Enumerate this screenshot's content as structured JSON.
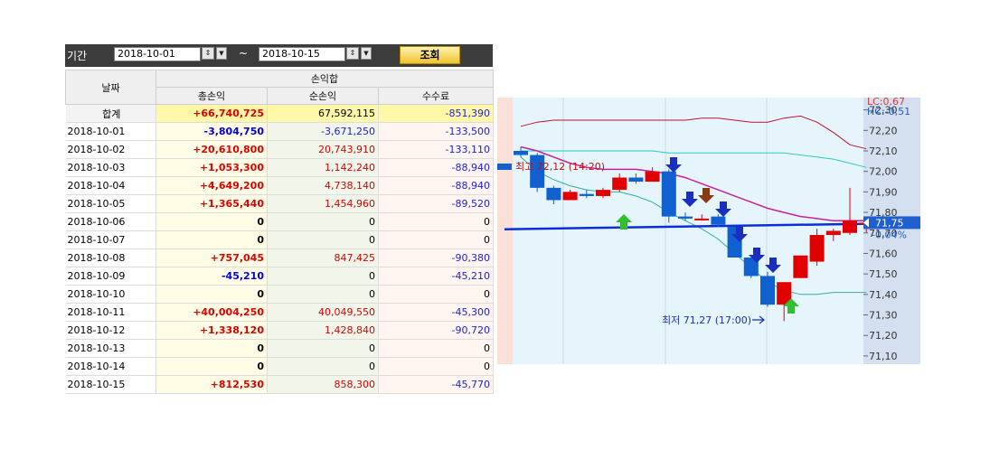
{
  "toolbar": {
    "period_label": "기간",
    "start_date": "2018-10-01",
    "separator": "~",
    "end_date": "2018-10-15",
    "query_label": "조회"
  },
  "table": {
    "header_date": "날짜",
    "header_group": "손익합",
    "col_total": "총손익",
    "col_net": "순손익",
    "col_fee": "수수료",
    "summary": {
      "label": "합계",
      "total": "+66,740,725",
      "net": "67,592,115",
      "fee": "-851,390"
    },
    "rows": [
      {
        "date": "2018-10-01",
        "total": "-3,804,750",
        "net": "-3,671,250",
        "fee": "-133,500"
      },
      {
        "date": "2018-10-02",
        "total": "+20,610,800",
        "net": "20,743,910",
        "fee": "-133,110"
      },
      {
        "date": "2018-10-03",
        "total": "+1,053,300",
        "net": "1,142,240",
        "fee": "-88,940"
      },
      {
        "date": "2018-10-04",
        "total": "+4,649,200",
        "net": "4,738,140",
        "fee": "-88,940"
      },
      {
        "date": "2018-10-05",
        "total": "+1,365,440",
        "net": "1,454,960",
        "fee": "-89,520"
      },
      {
        "date": "2018-10-06",
        "total": "0",
        "net": "0",
        "fee": "0"
      },
      {
        "date": "2018-10-07",
        "total": "0",
        "net": "0",
        "fee": "0"
      },
      {
        "date": "2018-10-08",
        "total": "+757,045",
        "net": "847,425",
        "fee": "-90,380"
      },
      {
        "date": "2018-10-09",
        "total": "-45,210",
        "net": "0",
        "fee": "-45,210"
      },
      {
        "date": "2018-10-10",
        "total": "0",
        "net": "0",
        "fee": "0"
      },
      {
        "date": "2018-10-11",
        "total": "+40,004,250",
        "net": "40,049,550",
        "fee": "-45,300"
      },
      {
        "date": "2018-10-12",
        "total": "+1,338,120",
        "net": "1,428,840",
        "fee": "-90,720"
      },
      {
        "date": "2018-10-13",
        "total": "0",
        "net": "0",
        "fee": "0"
      },
      {
        "date": "2018-10-14",
        "total": "0",
        "net": "0",
        "fee": "0"
      },
      {
        "date": "2018-10-15",
        "total": "+812,530",
        "net": "858,300",
        "fee": "-45,770"
      }
    ]
  },
  "chart_data": {
    "type": "candlestick",
    "y_ticks": [
      "72,30",
      "72,20",
      "72,10",
      "72,00",
      "71,90",
      "71,80",
      "71,70",
      "71,60",
      "71,50",
      "71,40",
      "71,30",
      "71,20",
      "71,10"
    ],
    "ylim": [
      71.06,
      72.36
    ],
    "lc_label": "LC:0,67",
    "hc_label": "HC:-0,51",
    "current_price": "71,75",
    "current_change": "-0,04%",
    "high_annotation": "최고 72,12 (14:20)",
    "low_annotation": "최저 71,27 (17:00)",
    "reference_level": 71.74,
    "colors": {
      "up": "#e00000",
      "down": "#1060d0",
      "buy_arrow": "#2fbf2f",
      "sell_arrow": "#1a2fbf",
      "exit_arrow": "#8b3a10",
      "reference_line": "#0a2fd8"
    },
    "candles": [
      {
        "o": 72.1,
        "h": 72.12,
        "l": 72.07,
        "c": 72.08
      },
      {
        "o": 72.08,
        "h": 72.09,
        "l": 71.9,
        "c": 71.92
      },
      {
        "o": 71.92,
        "h": 71.93,
        "l": 71.84,
        "c": 71.86
      },
      {
        "o": 71.86,
        "h": 71.91,
        "l": 71.86,
        "c": 71.9
      },
      {
        "o": 71.89,
        "h": 71.91,
        "l": 71.87,
        "c": 71.88
      },
      {
        "o": 71.88,
        "h": 71.92,
        "l": 71.87,
        "c": 71.91
      },
      {
        "o": 71.91,
        "h": 71.99,
        "l": 71.9,
        "c": 71.97
      },
      {
        "o": 71.97,
        "h": 71.99,
        "l": 71.94,
        "c": 71.95
      },
      {
        "o": 71.95,
        "h": 72.02,
        "l": 71.95,
        "c": 72.0
      },
      {
        "o": 72.0,
        "h": 72.01,
        "l": 71.75,
        "c": 71.78
      },
      {
        "o": 71.78,
        "h": 71.8,
        "l": 71.76,
        "c": 71.77
      },
      {
        "o": 71.77,
        "h": 71.79,
        "l": 71.76,
        "c": 71.77
      },
      {
        "o": 71.78,
        "h": 71.79,
        "l": 71.73,
        "c": 71.74
      },
      {
        "o": 71.73,
        "h": 71.73,
        "l": 71.58,
        "c": 71.58
      },
      {
        "o": 71.58,
        "h": 71.58,
        "l": 71.48,
        "c": 71.49
      },
      {
        "o": 71.49,
        "h": 71.51,
        "l": 71.34,
        "c": 71.35
      },
      {
        "o": 71.35,
        "h": 71.46,
        "l": 71.27,
        "c": 71.46
      },
      {
        "o": 71.48,
        "h": 71.59,
        "l": 71.48,
        "c": 71.59
      },
      {
        "o": 71.56,
        "h": 71.72,
        "l": 71.54,
        "c": 71.69
      },
      {
        "o": 71.69,
        "h": 71.72,
        "l": 71.66,
        "c": 71.71
      },
      {
        "o": 71.7,
        "h": 71.92,
        "l": 71.69,
        "c": 71.76
      },
      {
        "o": 71.75,
        "h": 71.78,
        "l": 71.7,
        "c": 71.75
      }
    ]
  }
}
